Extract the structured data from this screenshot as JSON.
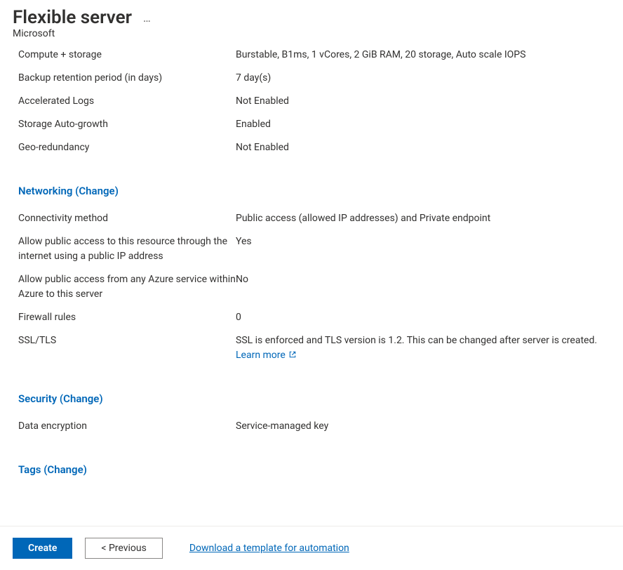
{
  "header": {
    "title": "Flexible server",
    "subtitle": "Microsoft",
    "more_label": "…"
  },
  "rows_top": [
    {
      "label": "Compute + storage",
      "value": "Burstable, B1ms, 1 vCores, 2 GiB RAM, 20 storage, Auto scale IOPS"
    },
    {
      "label": "Backup retention period (in days)",
      "value": "7 day(s)"
    },
    {
      "label": "Accelerated Logs",
      "value": "Not Enabled"
    },
    {
      "label": "Storage Auto-growth",
      "value": "Enabled"
    },
    {
      "label": "Geo-redundancy",
      "value": "Not Enabled"
    }
  ],
  "sections": {
    "networking": {
      "heading": "Networking (Change)",
      "rows": [
        {
          "label": "Connectivity method",
          "value": "Public access (allowed IP addresses) and Private endpoint"
        },
        {
          "label": "Allow public access to this resource through the internet using a public IP address",
          "value": "Yes"
        },
        {
          "label": "Allow public access from any Azure service within Azure to this server",
          "value": "No"
        },
        {
          "label": "Firewall rules",
          "value": "0"
        }
      ],
      "ssl": {
        "label": "SSL/TLS",
        "value_prefix": "SSL is enforced and TLS version is 1.2. This can be changed after server is created. ",
        "link_text": "Learn more"
      }
    },
    "security": {
      "heading": "Security (Change)",
      "rows": [
        {
          "label": "Data encryption",
          "value": "Service-managed key"
        }
      ]
    },
    "tags": {
      "heading": "Tags (Change)"
    }
  },
  "footer": {
    "create": "Create",
    "previous": "< Previous",
    "download_link": "Download a template for automation"
  }
}
